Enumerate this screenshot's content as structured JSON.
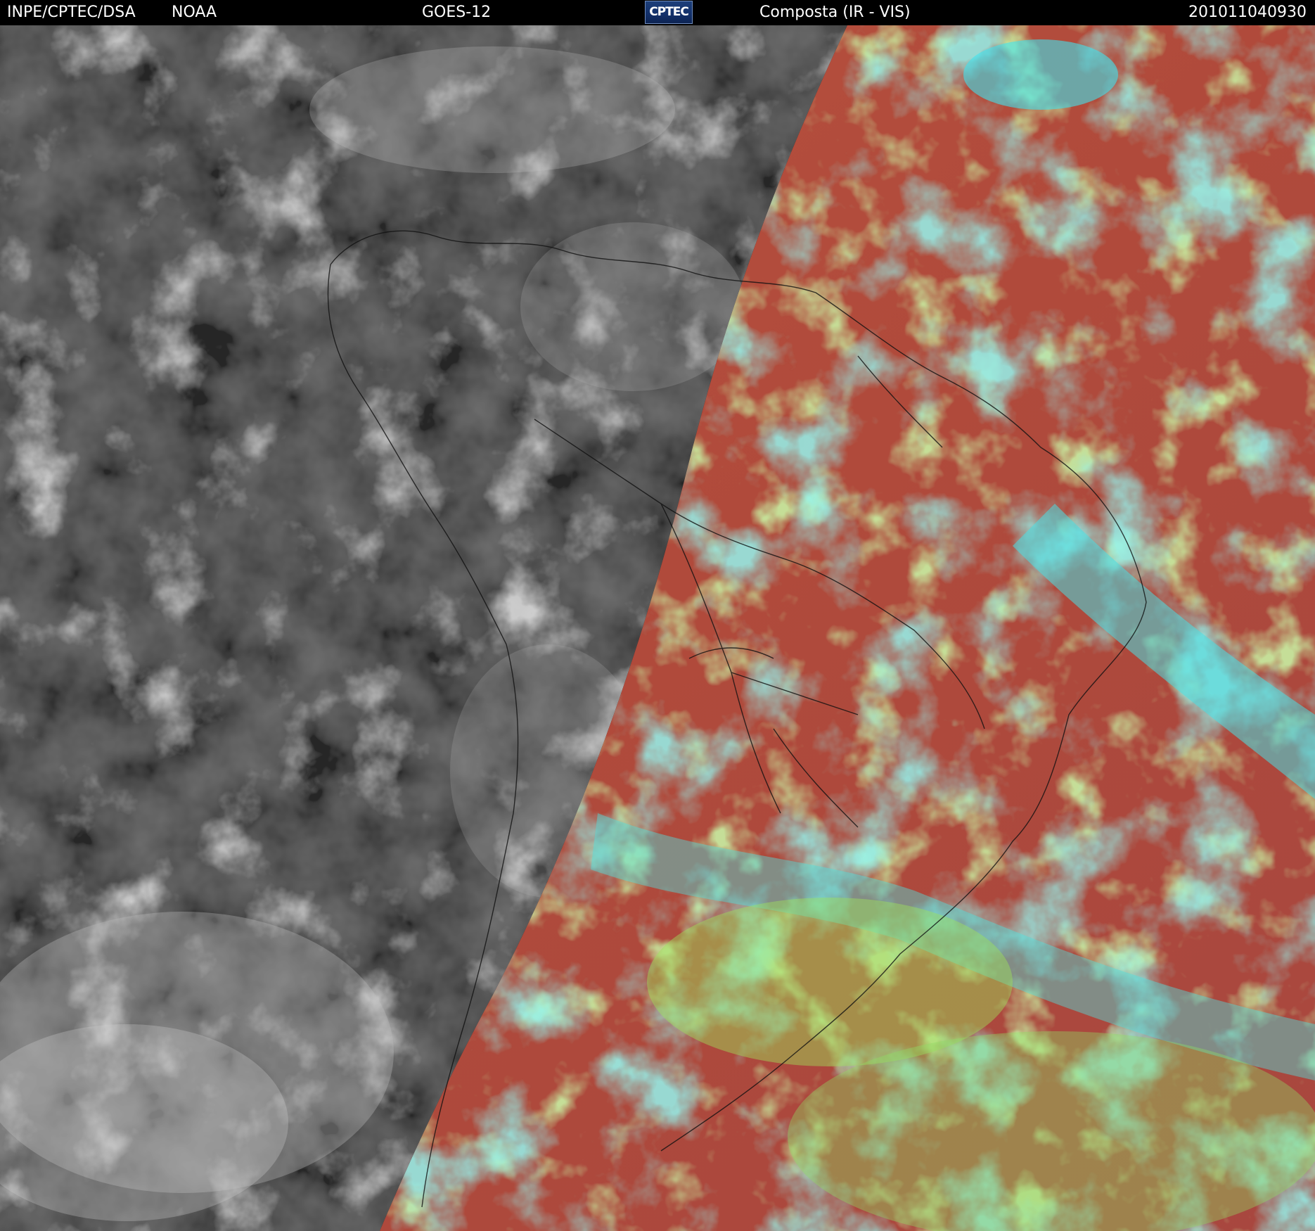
{
  "header": {
    "agency": "INPE/CPTEC/DSA",
    "provider": "NOAA",
    "satellite": "GOES-12",
    "logo_text": "CPTEC",
    "product": "Composta (IR - VIS)",
    "timestamp": "201011040930"
  },
  "colors": {
    "header_bg": "#000000",
    "header_text": "#ffffff",
    "night_ir": "#3a3a3a",
    "day_ocean_land": "#b24d3c",
    "day_low_cloud": "#8cd65a",
    "day_high_cloud": "#46e0e6",
    "coastline": "#111111"
  },
  "icons": {
    "logo": "cptec-logo"
  }
}
